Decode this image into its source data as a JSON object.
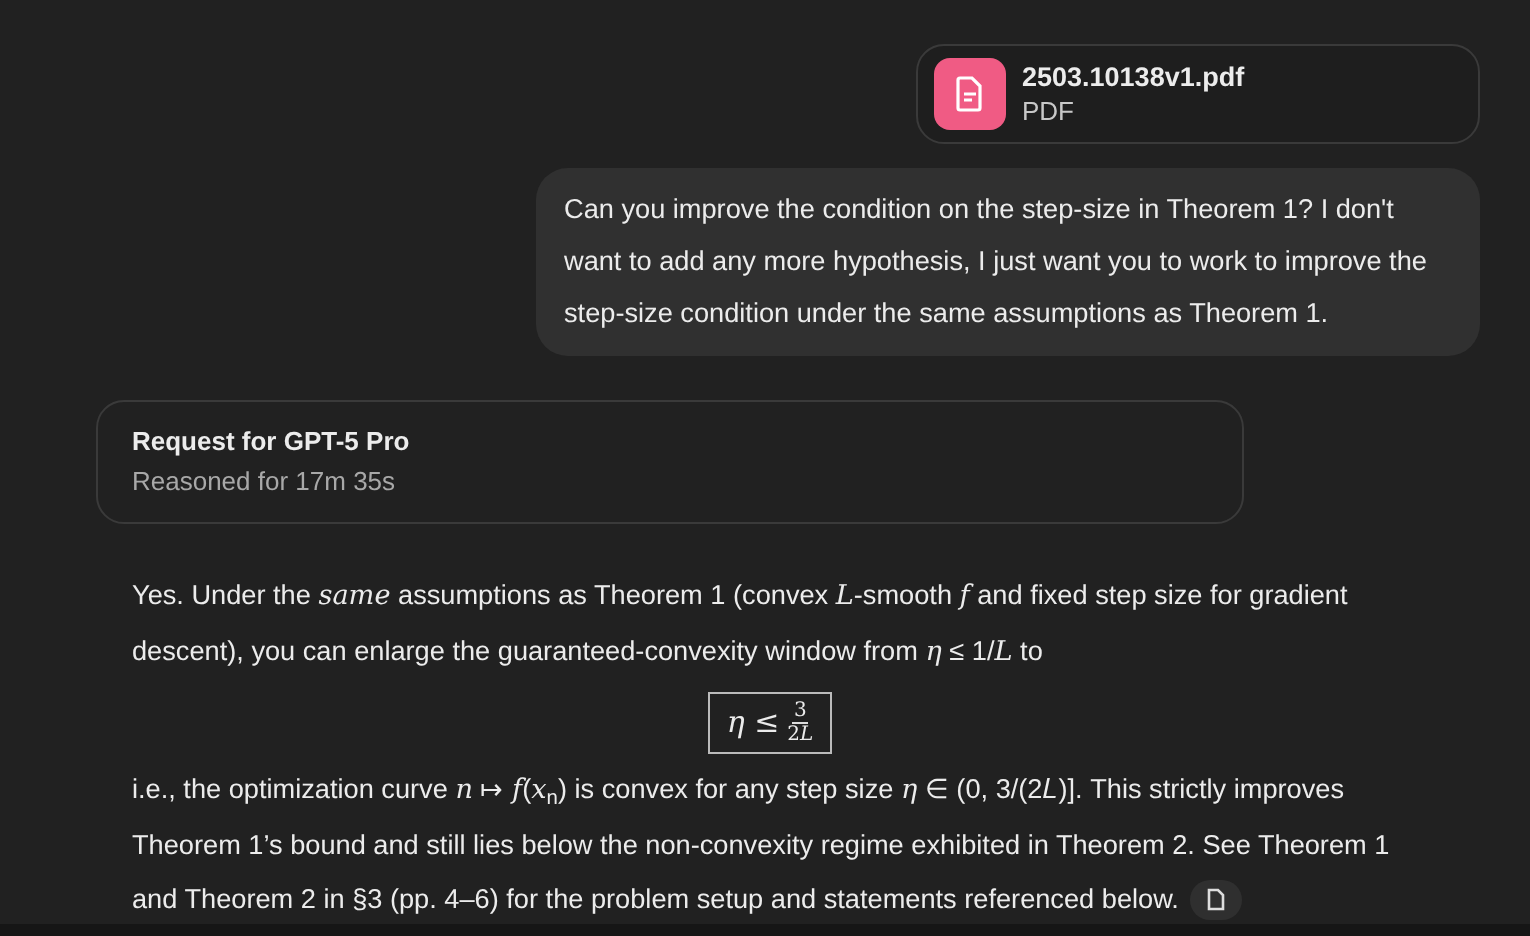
{
  "attachment": {
    "filename": "2503.10138v1.pdf",
    "filetype": "PDF"
  },
  "user_message": "Can you improve the condition on the step-size in Theorem 1? I don't want to add any more hypothesis, I just want you to work to improve the step-size condition under the same assumptions as Theorem 1.",
  "request": {
    "title": "Request for GPT-5 Pro",
    "subtitle": "Reasoned for 17m 35s"
  },
  "answer": {
    "paragraph_1": "Yes. Under the *same* assumptions as Theorem 1 (convex *L*-smooth *f* and fixed step size for gradient descent), you can enlarge the guaranteed-convexity window from *η* ≤ 1/*L* to",
    "formula": {
      "lhs": "*η* ≤",
      "numerator": "3",
      "denominator": "2𝐿"
    },
    "paragraph_2": "i.e., the optimization curve *n* ↦ *f*(*x*$_{n}$) is convex for any step size *η* ∈ (0, 3/(2𝐿)]. This strictly improves Theorem 1’s bound and still lies below the non-convexity regime exhibited in Theorem 2. See Theorem 1 and Theorem 2 in §3 (pp. 4–6) for the problem setup and statements referenced below.",
    "citation": {
      "kind": "document"
    }
  }
}
